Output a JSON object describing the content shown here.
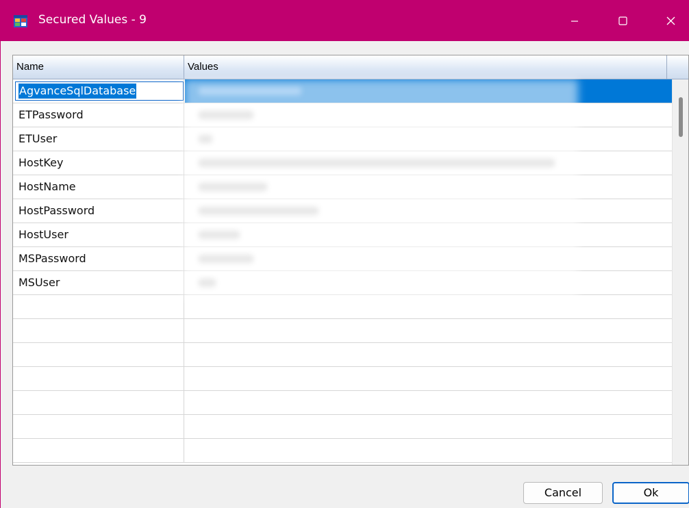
{
  "window": {
    "title": "Secured Values - 9"
  },
  "grid": {
    "columns": [
      "Name",
      "Values"
    ],
    "rows": [
      {
        "name": "AgvanceSqlDatabase"
      },
      {
        "name": "ETPassword"
      },
      {
        "name": "ETUser"
      },
      {
        "name": "HostKey"
      },
      {
        "name": "HostName"
      },
      {
        "name": "HostPassword"
      },
      {
        "name": "HostUser"
      },
      {
        "name": "MSPassword"
      },
      {
        "name": "MSUser"
      }
    ]
  },
  "buttons": {
    "cancel": "Cancel",
    "ok": "Ok"
  },
  "colors": {
    "titlebar": "#c0006f",
    "selection": "#0078d7"
  }
}
